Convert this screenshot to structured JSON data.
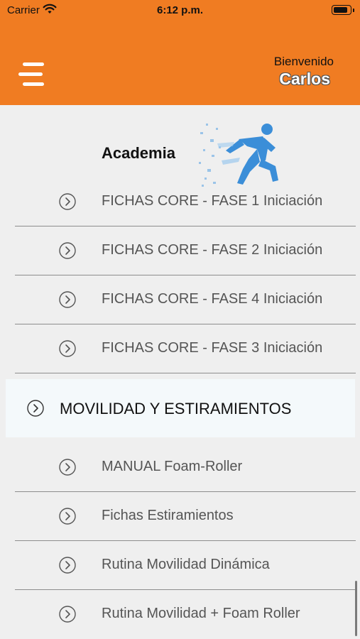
{
  "status_bar": {
    "carrier": "Carrier",
    "time": "6:12 p.m."
  },
  "header": {
    "welcome": "Bienvenido",
    "user_name": "Carlos",
    "menu_icon": "hamburger-menu-icon",
    "accent_color": "#f07c22"
  },
  "academy": {
    "title": "Academia"
  },
  "list": {
    "items_top": [
      {
        "label": "FICHAS CORE - FASE 1 Iniciación"
      },
      {
        "label": "FICHAS CORE - FASE 2 Iniciación"
      },
      {
        "label": "FICHAS CORE - FASE 4 Iniciación"
      },
      {
        "label": "FICHAS CORE - FASE 3 Iniciación"
      }
    ],
    "section_header": "MOVILIDAD Y ESTIRAMIENTOS",
    "items_bottom": [
      {
        "label": "MANUAL Foam-Roller"
      },
      {
        "label": "Fichas Estiramientos"
      },
      {
        "label": "Rutina Movilidad Dinámica"
      },
      {
        "label": "Rutina Movilidad + Foam Roller"
      }
    ]
  }
}
